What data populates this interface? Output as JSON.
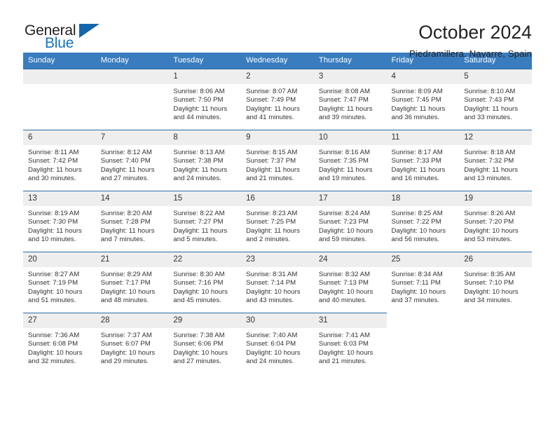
{
  "brand": {
    "name_part1": "General",
    "name_part2": "Blue",
    "triangle_color": "#1266ad",
    "accent_color": "#1573c0"
  },
  "header": {
    "title": "October 2024",
    "subtitle": "Piedramillera, Navarre, Spain"
  },
  "theme": {
    "header_row_bg": "#3a7dbf",
    "week_separator": "#2a6ca8",
    "daynum_bg": "#eeeeee",
    "text_color": "#333333"
  },
  "calendar": {
    "weekday_headers": [
      "Sunday",
      "Monday",
      "Tuesday",
      "Wednesday",
      "Thursday",
      "Friday",
      "Saturday"
    ],
    "weeks": [
      [
        {
          "day": "",
          "lines": []
        },
        {
          "day": "",
          "lines": []
        },
        {
          "day": "1",
          "lines": [
            "Sunrise: 8:06 AM",
            "Sunset: 7:50 PM",
            "Daylight: 11 hours",
            "and 44 minutes."
          ]
        },
        {
          "day": "2",
          "lines": [
            "Sunrise: 8:07 AM",
            "Sunset: 7:49 PM",
            "Daylight: 11 hours",
            "and 41 minutes."
          ]
        },
        {
          "day": "3",
          "lines": [
            "Sunrise: 8:08 AM",
            "Sunset: 7:47 PM",
            "Daylight: 11 hours",
            "and 39 minutes."
          ]
        },
        {
          "day": "4",
          "lines": [
            "Sunrise: 8:09 AM",
            "Sunset: 7:45 PM",
            "Daylight: 11 hours",
            "and 36 minutes."
          ]
        },
        {
          "day": "5",
          "lines": [
            "Sunrise: 8:10 AM",
            "Sunset: 7:43 PM",
            "Daylight: 11 hours",
            "and 33 minutes."
          ]
        }
      ],
      [
        {
          "day": "6",
          "lines": [
            "Sunrise: 8:11 AM",
            "Sunset: 7:42 PM",
            "Daylight: 11 hours",
            "and 30 minutes."
          ]
        },
        {
          "day": "7",
          "lines": [
            "Sunrise: 8:12 AM",
            "Sunset: 7:40 PM",
            "Daylight: 11 hours",
            "and 27 minutes."
          ]
        },
        {
          "day": "8",
          "lines": [
            "Sunrise: 8:13 AM",
            "Sunset: 7:38 PM",
            "Daylight: 11 hours",
            "and 24 minutes."
          ]
        },
        {
          "day": "9",
          "lines": [
            "Sunrise: 8:15 AM",
            "Sunset: 7:37 PM",
            "Daylight: 11 hours",
            "and 21 minutes."
          ]
        },
        {
          "day": "10",
          "lines": [
            "Sunrise: 8:16 AM",
            "Sunset: 7:35 PM",
            "Daylight: 11 hours",
            "and 19 minutes."
          ]
        },
        {
          "day": "11",
          "lines": [
            "Sunrise: 8:17 AM",
            "Sunset: 7:33 PM",
            "Daylight: 11 hours",
            "and 16 minutes."
          ]
        },
        {
          "day": "12",
          "lines": [
            "Sunrise: 8:18 AM",
            "Sunset: 7:32 PM",
            "Daylight: 11 hours",
            "and 13 minutes."
          ]
        }
      ],
      [
        {
          "day": "13",
          "lines": [
            "Sunrise: 8:19 AM",
            "Sunset: 7:30 PM",
            "Daylight: 11 hours",
            "and 10 minutes."
          ]
        },
        {
          "day": "14",
          "lines": [
            "Sunrise: 8:20 AM",
            "Sunset: 7:28 PM",
            "Daylight: 11 hours",
            "and 7 minutes."
          ]
        },
        {
          "day": "15",
          "lines": [
            "Sunrise: 8:22 AM",
            "Sunset: 7:27 PM",
            "Daylight: 11 hours",
            "and 5 minutes."
          ]
        },
        {
          "day": "16",
          "lines": [
            "Sunrise: 8:23 AM",
            "Sunset: 7:25 PM",
            "Daylight: 11 hours",
            "and 2 minutes."
          ]
        },
        {
          "day": "17",
          "lines": [
            "Sunrise: 8:24 AM",
            "Sunset: 7:23 PM",
            "Daylight: 10 hours",
            "and 59 minutes."
          ]
        },
        {
          "day": "18",
          "lines": [
            "Sunrise: 8:25 AM",
            "Sunset: 7:22 PM",
            "Daylight: 10 hours",
            "and 56 minutes."
          ]
        },
        {
          "day": "19",
          "lines": [
            "Sunrise: 8:26 AM",
            "Sunset: 7:20 PM",
            "Daylight: 10 hours",
            "and 53 minutes."
          ]
        }
      ],
      [
        {
          "day": "20",
          "lines": [
            "Sunrise: 8:27 AM",
            "Sunset: 7:19 PM",
            "Daylight: 10 hours",
            "and 51 minutes."
          ]
        },
        {
          "day": "21",
          "lines": [
            "Sunrise: 8:29 AM",
            "Sunset: 7:17 PM",
            "Daylight: 10 hours",
            "and 48 minutes."
          ]
        },
        {
          "day": "22",
          "lines": [
            "Sunrise: 8:30 AM",
            "Sunset: 7:16 PM",
            "Daylight: 10 hours",
            "and 45 minutes."
          ]
        },
        {
          "day": "23",
          "lines": [
            "Sunrise: 8:31 AM",
            "Sunset: 7:14 PM",
            "Daylight: 10 hours",
            "and 43 minutes."
          ]
        },
        {
          "day": "24",
          "lines": [
            "Sunrise: 8:32 AM",
            "Sunset: 7:13 PM",
            "Daylight: 10 hours",
            "and 40 minutes."
          ]
        },
        {
          "day": "25",
          "lines": [
            "Sunrise: 8:34 AM",
            "Sunset: 7:11 PM",
            "Daylight: 10 hours",
            "and 37 minutes."
          ]
        },
        {
          "day": "26",
          "lines": [
            "Sunrise: 8:35 AM",
            "Sunset: 7:10 PM",
            "Daylight: 10 hours",
            "and 34 minutes."
          ]
        }
      ],
      [
        {
          "day": "27",
          "lines": [
            "Sunrise: 7:36 AM",
            "Sunset: 6:08 PM",
            "Daylight: 10 hours",
            "and 32 minutes."
          ]
        },
        {
          "day": "28",
          "lines": [
            "Sunrise: 7:37 AM",
            "Sunset: 6:07 PM",
            "Daylight: 10 hours",
            "and 29 minutes."
          ]
        },
        {
          "day": "29",
          "lines": [
            "Sunrise: 7:38 AM",
            "Sunset: 6:06 PM",
            "Daylight: 10 hours",
            "and 27 minutes."
          ]
        },
        {
          "day": "30",
          "lines": [
            "Sunrise: 7:40 AM",
            "Sunset: 6:04 PM",
            "Daylight: 10 hours",
            "and 24 minutes."
          ]
        },
        {
          "day": "31",
          "lines": [
            "Sunrise: 7:41 AM",
            "Sunset: 6:03 PM",
            "Daylight: 10 hours",
            "and 21 minutes."
          ]
        },
        {
          "day": "",
          "lines": []
        },
        {
          "day": "",
          "lines": []
        }
      ]
    ]
  }
}
